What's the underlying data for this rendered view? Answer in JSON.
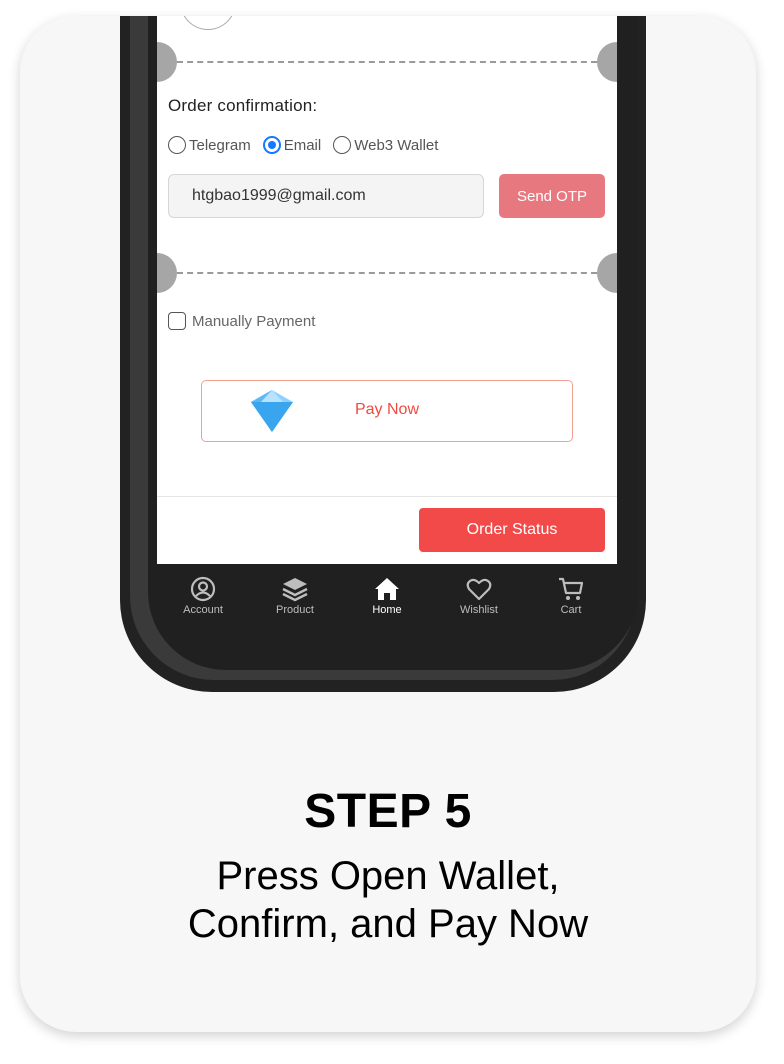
{
  "order_confirmation": {
    "title": "Order confirmation:",
    "options": [
      "Telegram",
      "Email",
      "Web3 Wallet"
    ],
    "selected_option": "Email",
    "email_value": "htgbao1999@gmail.com",
    "send_otp_label": "Send OTP"
  },
  "payment": {
    "manual_label": "Manually Payment",
    "manual_checked": false,
    "pay_now_label": "Pay Now"
  },
  "order_status_label": "Order Status",
  "nav": {
    "items": [
      {
        "label": "Account",
        "icon": "account-icon"
      },
      {
        "label": "Product",
        "icon": "layers-icon"
      },
      {
        "label": "Home",
        "icon": "home-icon"
      },
      {
        "label": "Wishlist",
        "icon": "heart-icon"
      },
      {
        "label": "Cart",
        "icon": "cart-icon"
      }
    ],
    "active": "Home"
  },
  "step": {
    "title": "STEP 5",
    "description_line1": "Press Open Wallet,",
    "description_line2": "Confirm, and Pay Now"
  },
  "colors": {
    "accent": "#f24949",
    "send_otp": "#e87880",
    "radio_selected": "#1677ff",
    "pay_now_text": "#ef4a40"
  }
}
